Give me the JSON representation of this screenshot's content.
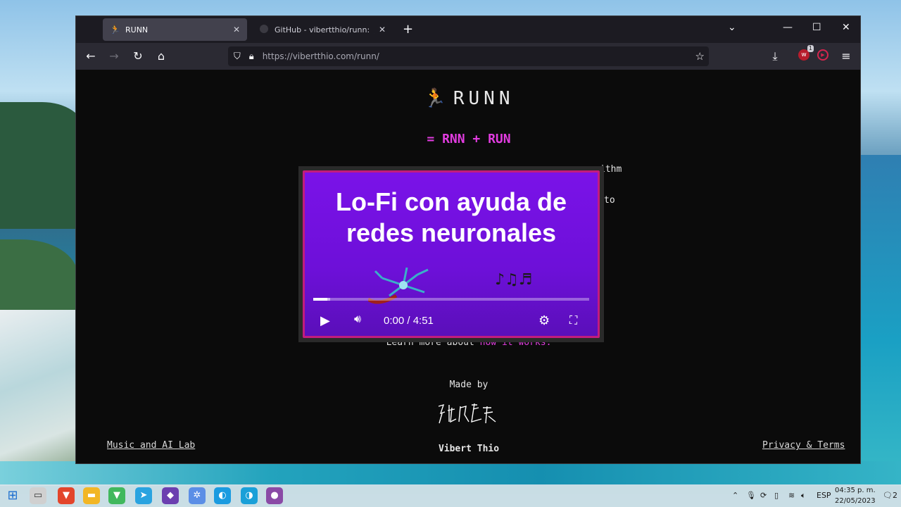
{
  "browser": {
    "tabs": [
      {
        "icon": "🏃",
        "label": "RUNN",
        "active": true
      },
      {
        "icon": "github-icon",
        "label": "GitHub - vibertthio/runn: 🏃 Run (…",
        "active": false
      }
    ],
    "url": {
      "host": "https://vibertthio.com",
      "path": "/runn/"
    },
    "extension_badge": "1"
  },
  "page": {
    "title": "RUNN",
    "title_icon": "🏃",
    "subtitle": "= RNN + RUN",
    "desc_line1": "ithm",
    "desc_line2": "to",
    "learn_prefix": "Learn more about ",
    "learn_link": "how it works.",
    "made_by": "Made by",
    "author": "Vibert Thio",
    "footer_left": "Music and AI Lab",
    "footer_right": "Privacy & Terms"
  },
  "video": {
    "title_line1": "Lo-Fi con ayuda de",
    "title_line2": "redes neuronales",
    "time": "0:00 / 4:51",
    "progress": 0.05,
    "buffered": 0.06
  },
  "taskbar": {
    "lang": "ESP",
    "time": "04:35 p. m.",
    "date": "22/05/2023",
    "notifications": "2"
  },
  "colors": {
    "accent": "#e23ce0",
    "video_bg": "#7a12e8",
    "video_border": "#c21c7d"
  }
}
